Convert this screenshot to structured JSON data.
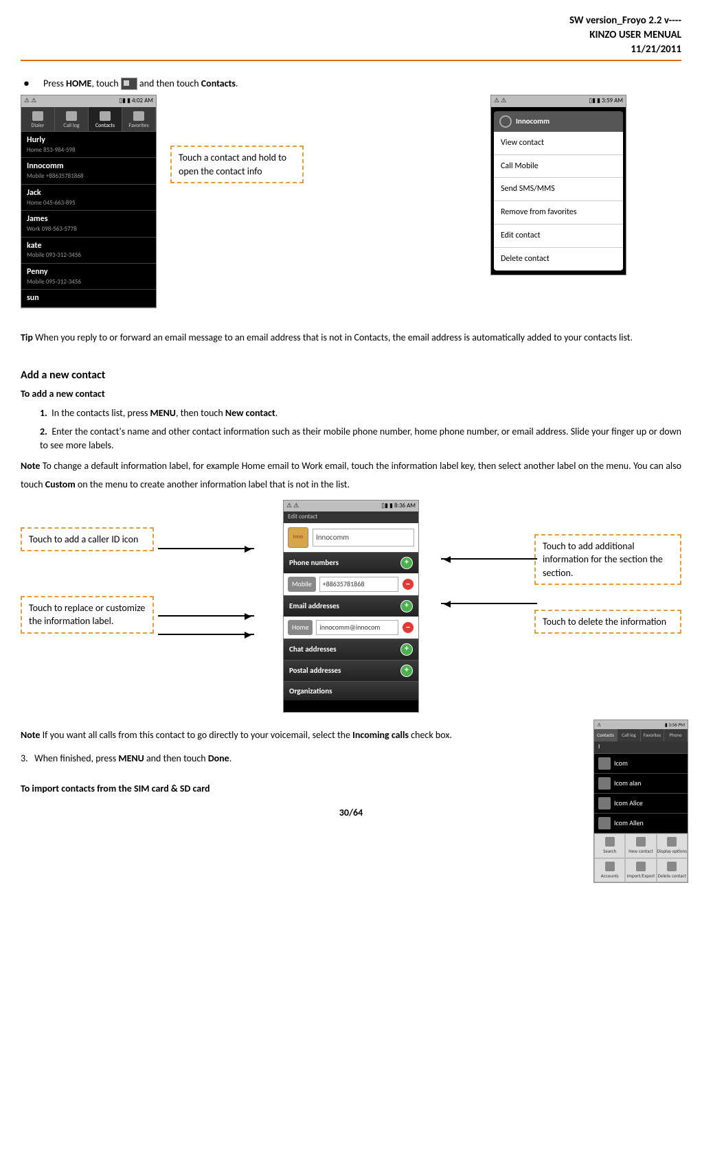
{
  "header": {
    "line1": "SW version_Froyo 2.2 v----",
    "line2": "KINZO USER MENUAL",
    "line3": "11/21/2011"
  },
  "intro": {
    "pre": "Press ",
    "home": "HOME",
    "mid": ", touch ",
    "post": " and then touch ",
    "contacts": "Contacts",
    "end": "."
  },
  "screen1": {
    "time": "4:02 AM",
    "tabs": [
      "Dialer",
      "Call log",
      "Contacts",
      "Favorites"
    ],
    "contacts": [
      {
        "name": "Hurly",
        "info": "Home 853-984-598"
      },
      {
        "name": "Innocomm",
        "info": "Mobile +88635781868"
      },
      {
        "name": "Jack",
        "info": "Home 045-663-895"
      },
      {
        "name": "James",
        "info": "Work 098-563-5778"
      },
      {
        "name": "kate",
        "info": "Mobile 093-312-3456"
      },
      {
        "name": "Penny",
        "info": "Mobile 095-312-3456"
      },
      {
        "name": "sun",
        "info": ""
      }
    ]
  },
  "callout1": "Touch a contact and hold to open the contact info",
  "screen2": {
    "time": "3:59 AM",
    "title": "Innocomm",
    "items": [
      "View contact",
      "Call Mobile",
      "Send SMS/MMS",
      "Remove from favorites",
      "Edit contact",
      "Delete contact"
    ]
  },
  "tip": {
    "label": "Tip",
    "text": " When you reply to or forward an email message to an email address that is not in Contacts, the email address is automatically added to your contacts list."
  },
  "add_section": {
    "heading": "Add a new contact",
    "sub": "To add a new contact",
    "step1_pre": "In the contacts list, press ",
    "step1_menu": "MENU",
    "step1_mid": ", then touch ",
    "step1_new": "New contact",
    "step1_end": ".",
    "step2": "Enter the contact's name and other contact information such as their mobile phone number, home phone number, or email address. Slide your finger up or down to see more labels.",
    "note_label": "Note",
    "note_pre": " To change a default information label, for example Home email to Work email, touch the information label key, then select another label on the menu. You can also touch ",
    "note_custom": "Custom",
    "note_post": " on the menu to create another information label that is not in the list."
  },
  "edit_screen": {
    "time": "8:36 AM",
    "title": "Edit contact",
    "name": "Innocomm",
    "sections": {
      "phone": "Phone numbers",
      "phone_label": "Mobile",
      "phone_val": "+88635781868",
      "email": "Email addresses",
      "email_label": "Home",
      "email_val": "innocomm@innocom",
      "chat": "Chat addresses",
      "postal": "Postal addresses",
      "org": "Organizations"
    }
  },
  "callouts": {
    "c_left1": "Touch to add a caller ID icon",
    "c_left2": "Touch to replace or customize the information label.",
    "c_right1": "Touch to add additional information for the section the section.",
    "c_right2": "Touch to delete the information"
  },
  "note2": {
    "label": "Note",
    "pre": " If you want all calls from this contact to go directly to your voicemail, select the ",
    "incoming": "Incoming calls",
    "post": " check box."
  },
  "step3": {
    "pre": "When finished, press ",
    "menu": "MENU",
    "mid": " and then touch ",
    "done": "Done",
    "end": "."
  },
  "import_h": "To import contacts from the SIM card & SD card",
  "mini": {
    "time": "3:56 PM",
    "tabs": [
      "Contacts",
      "Call log",
      "Favorites",
      "Phone"
    ],
    "letter": "I",
    "items": [
      "Icom",
      "Icom alan",
      "Icom Alice",
      "Icom Allen"
    ],
    "menu": [
      "Search",
      "New contact",
      "Display options",
      "Accounts",
      "Import/Export",
      "Delete contact"
    ]
  },
  "page": "30/64"
}
